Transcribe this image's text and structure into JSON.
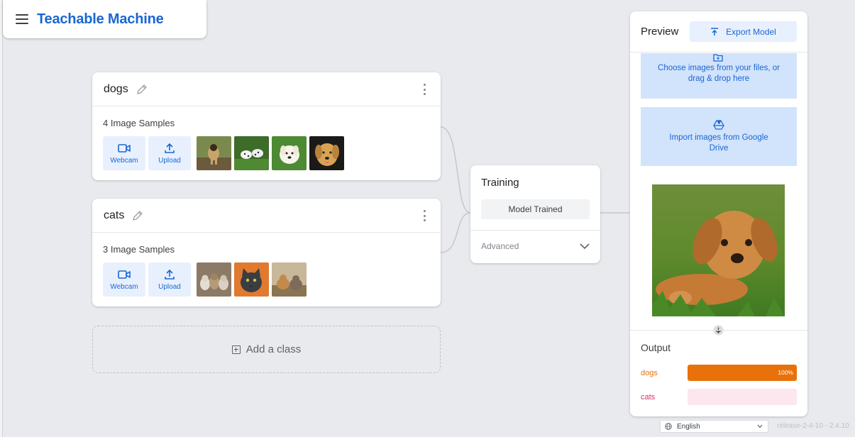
{
  "app": {
    "title": "Teachable Machine"
  },
  "classes": [
    {
      "name": "dogs",
      "sample_count": "4 Image Samples",
      "webcam_label": "Webcam",
      "upload_label": "Upload"
    },
    {
      "name": "cats",
      "sample_count": "3 Image Samples",
      "webcam_label": "Webcam",
      "upload_label": "Upload"
    }
  ],
  "add_class": {
    "label": "Add a class"
  },
  "training": {
    "title": "Training",
    "button_label": "Model Trained",
    "advanced_label": "Advanced"
  },
  "preview": {
    "title": "Preview",
    "export_label": "Export Model",
    "choose_files_text": "Choose images from your files, or drag & drop here",
    "drive_text": "Import images from Google Drive",
    "output_title": "Output",
    "outputs": [
      {
        "label": "dogs",
        "percent_text": "100%",
        "confidence": 1.0,
        "color": "#e8710a",
        "track_color": "#fce8d8"
      },
      {
        "label": "cats",
        "percent_text": "",
        "confidence": 0.0,
        "color": "#d93070",
        "track_color": "#fde7ef"
      }
    ]
  },
  "footer": {
    "language": "English",
    "release": "release-2-4-10 - 2.4.10"
  },
  "colors": {
    "accent": "#1967d2",
    "accent_bg": "#e8f0fe",
    "panel_bg": "#d2e3fc",
    "page_bg": "#e8eaed"
  }
}
